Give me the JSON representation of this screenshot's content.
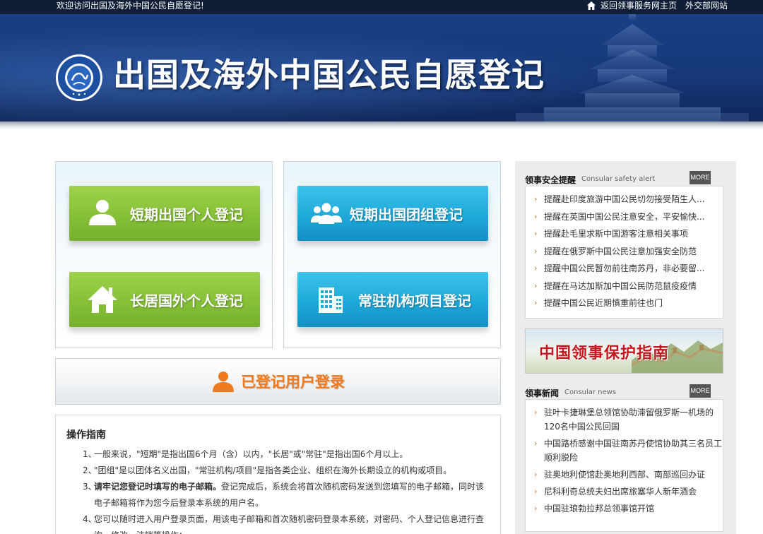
{
  "topbar": {
    "welcome": "欢迎访问出国及海外中国公民自愿登记!",
    "home_link": "返回领事服务网主页",
    "mfa_link": "外交部网站"
  },
  "banner": {
    "title": "出国及海外中国公民自愿登记"
  },
  "registration": {
    "short_personal": "短期出国个人登记",
    "short_group": "短期出国团组登记",
    "long_personal": "长居国外个人登记",
    "org_project": "常驻机构项目登记"
  },
  "login": {
    "label": "已登记用户登录"
  },
  "guide": {
    "title": "操作指南",
    "items": [
      {
        "num": "1、",
        "text": "一般来说，\"短期\"是指出国6个月（含）以内，\"长居\"或\"常驻\"是指出国6个月以上。"
      },
      {
        "num": "2、",
        "text": "\"团组\"是以团体名义出国，\"常驻机构/项目\"是指各类企业、组织在海外长期设立的机构或项目。"
      },
      {
        "num": "3、",
        "bold": "请牢记您登记时填写的电子邮箱。",
        "text": "登记完成后，系统会将首次随机密码发送到您填写的电子邮箱，同时该电子邮箱将作为您今后登录本系统的用户名。"
      },
      {
        "num": "4、",
        "text": "您可以随时进入用户登录页面，用该电子邮箱和首次随机密码登录本系统，对密码、个人登记信息进行查询、修改、注销等操作；"
      }
    ]
  },
  "alerts": {
    "title_zh": "领事安全提醒",
    "title_en": "Consular safety alert",
    "more": "MORE",
    "items": [
      "提醒赴印度旅游中国公民切勿接受陌生人...",
      "提醒在英国中国公民注意安全，平安愉快...",
      "提醒赴毛里求斯中国游客注意相关事项",
      "提醒在俄罗斯中国公民注意加强安全防范",
      "提醒中国公民暂勿前往南苏丹，非必要留...",
      "提醒在马达加斯加中国公民防范鼠疫疫情",
      "提醒中国公民近期慎重前往也门"
    ]
  },
  "protection_guide": {
    "label": "中国领事保护指南"
  },
  "news": {
    "title_zh": "领事新闻",
    "title_en": "Consular news",
    "more": "MORE",
    "items": [
      "驻叶卡捷琳堡总领馆协助滞留俄罗斯一机场的120名中国公民回国",
      "中国路桥感谢中国驻南苏丹使馆协助其三名员工顺利脱险",
      "驻奥地利使馆赴奥地利西部、南部巡回办证",
      "尼科利奇总统夫妇出席旅塞华人新年酒会",
      "中国驻琅勃拉邦总领事馆开馆"
    ]
  },
  "colors": {
    "green_button": "#86c037",
    "blue_button": "#1ea9d9",
    "login_orange": "#f07a1e",
    "arrow_orange": "#e26a1a",
    "banner_blue": "#16387a"
  },
  "icons": {
    "home": "home-icon",
    "person": "person-icon",
    "group": "group-icon",
    "house": "house-icon",
    "building": "building-icon",
    "user_login": "user-icon",
    "emblem": "consular-emblem"
  }
}
